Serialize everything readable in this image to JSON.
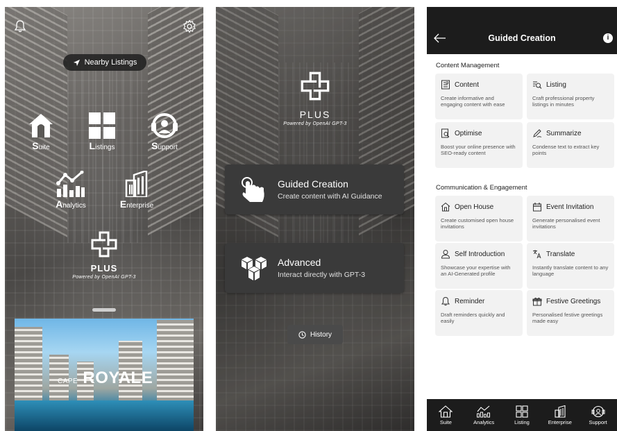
{
  "screen1": {
    "nearby_label": "Nearby Listings",
    "nav": [
      {
        "initial": "S",
        "rest": "uite"
      },
      {
        "initial": "L",
        "rest": "istings"
      },
      {
        "initial": "S",
        "rest": "upport"
      },
      {
        "initial": "A",
        "rest": "nalytics"
      },
      {
        "initial": "E",
        "rest": "nterprise"
      }
    ],
    "plus_word": "PLUS",
    "plus_sub": "Powered by OpenAI GPT-3",
    "promo": {
      "small": "CAPE",
      "big": "ROYALE"
    }
  },
  "screen2": {
    "plus_word": "PLUS",
    "plus_sub": "Powered by OpenAI GPT-3",
    "guided": {
      "title": "Guided Creation",
      "subtitle": "Create content with AI Guidance"
    },
    "advanced": {
      "title": "Advanced",
      "subtitle": "Interact directly with GPT-3"
    },
    "history_label": "History"
  },
  "screen3": {
    "title": "Guided Creation",
    "info_glyph": "i",
    "section1": "Content Management",
    "section2": "Communication & Engagement",
    "cards": [
      {
        "title": "Content",
        "desc": "Create informative and engaging content with ease",
        "icon": "document-icon"
      },
      {
        "title": "Listing",
        "desc": "Craft professional property listings in minutes",
        "icon": "list-search-icon"
      },
      {
        "title": "Optimise",
        "desc": "Boost your online presence with SEO-ready content",
        "icon": "doc-search-icon"
      },
      {
        "title": "Summarize",
        "desc": "Condense text to extract key points",
        "icon": "pen-icon"
      },
      {
        "title": "Open House",
        "desc": "Create customised open house invitations",
        "icon": "house-icon"
      },
      {
        "title": "Event Invitation",
        "desc": "Generate personalised event invitations",
        "icon": "calendar-icon"
      },
      {
        "title": "Self Introduction",
        "desc": "Showcase your expertise with an AI-Generated profile",
        "icon": "person-icon"
      },
      {
        "title": "Translate",
        "desc": "Instantly translate content to any language",
        "icon": "translate-icon"
      },
      {
        "title": "Reminder",
        "desc": "Draft reminders quickly and easily",
        "icon": "bell-icon"
      },
      {
        "title": "Festive Greetings",
        "desc": "Personalised festive greetings made easy",
        "icon": "gift-icon"
      }
    ],
    "tabs": [
      "Suite",
      "Analytics",
      "Listing",
      "Enterprise",
      "Support"
    ]
  },
  "colors": {
    "dark": "#1c1c1c",
    "card": "#f2f2f2",
    "menu_card": "#3a3a3a"
  }
}
